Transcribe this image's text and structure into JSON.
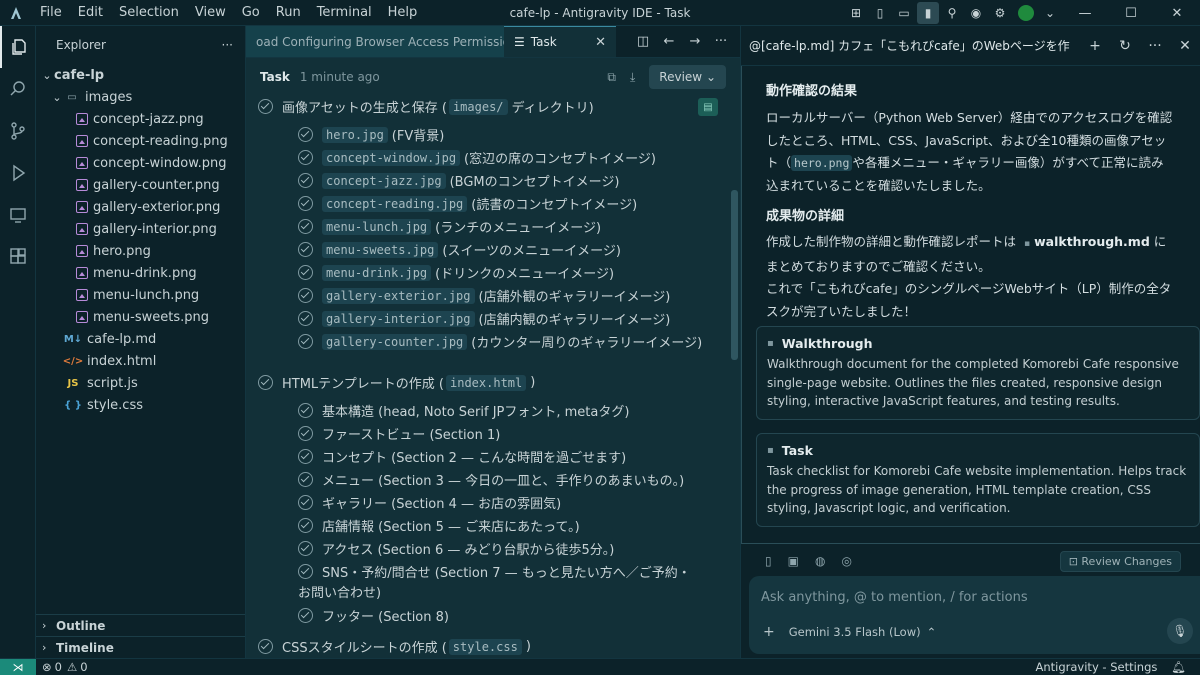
{
  "titlebar": {
    "menu": [
      "File",
      "Edit",
      "Selection",
      "View",
      "Go",
      "Run",
      "Terminal",
      "Help"
    ],
    "window_title": "cafe-lp - Antigravity IDE - Task"
  },
  "sidebar": {
    "title": "Explorer",
    "more": "···",
    "root": "cafe-lp",
    "folder": "images",
    "images": [
      "concept-jazz.png",
      "concept-reading.png",
      "concept-window.png",
      "gallery-counter.png",
      "gallery-exterior.png",
      "gallery-interior.png",
      "hero.png",
      "menu-drink.png",
      "menu-lunch.png",
      "menu-sweets.png"
    ],
    "files": [
      {
        "name": "cafe-lp.md",
        "icon": "M↓",
        "color": "#5fa8d3"
      },
      {
        "name": "index.html",
        "icon": "</>",
        "color": "#e07b3c"
      },
      {
        "name": "script.js",
        "icon": "JS",
        "color": "#e8c547"
      },
      {
        "name": "style.css",
        "icon": "{ }",
        "color": "#4aa3d6"
      }
    ],
    "outline": "Outline",
    "timeline": "Timeline"
  },
  "editor": {
    "tab_inactive": "oad  Configuring Browser Access Permissions",
    "tab_active": "Task",
    "task_title": "Task",
    "task_time": "1 minute ago",
    "review": "Review"
  },
  "task": {
    "section1": {
      "label": "画像アセットの生成と保存 (",
      "code": "images/",
      "suffix": " ディレクトリ)"
    },
    "assets": [
      {
        "code": "hero.jpg",
        "desc": "(FV背景)"
      },
      {
        "code": "concept-window.jpg",
        "desc": "(窓辺の席のコンセプトイメージ)"
      },
      {
        "code": "concept-jazz.jpg",
        "desc": "(BGMのコンセプトイメージ)"
      },
      {
        "code": "concept-reading.jpg",
        "desc": "(読書のコンセプトイメージ)"
      },
      {
        "code": "menu-lunch.jpg",
        "desc": "(ランチのメニューイメージ)"
      },
      {
        "code": "menu-sweets.jpg",
        "desc": "(スイーツのメニューイメージ)"
      },
      {
        "code": "menu-drink.jpg",
        "desc": "(ドリンクのメニューイメージ)"
      },
      {
        "code": "gallery-exterior.jpg",
        "desc": "(店舗外観のギャラリーイメージ)"
      },
      {
        "code": "gallery-interior.jpg",
        "desc": "(店舗内観のギャラリーイメージ)"
      },
      {
        "code": "gallery-counter.jpg",
        "desc": "(カウンター周りのギャラリーイメージ)"
      }
    ],
    "section2": {
      "label": "HTMLテンプレートの作成 (",
      "code": "index.html",
      "suffix": ")"
    },
    "html_items": [
      "基本構造 (head, Noto Serif JPフォント, metaタグ)",
      "ファーストビュー (Section 1)",
      "コンセプト (Section 2 — こんな時間を過ごせます)",
      "メニュー (Section 3 — 今日の一皿と、手作りのあまいもの。)",
      "ギャラリー (Section 4 — お店の雰囲気)",
      "店舗情報 (Section 5 — ご来店にあたって。)",
      "アクセス (Section 6 — みどり台駅から徒歩5分。)",
      "SNS・予約/問合せ (Section 7 — もっと見たい方へ／ご予約・",
      "フッター (Section 8)"
    ],
    "html_item_wrap": "お問い合わせ)",
    "section3": {
      "label": "CSSスタイルシートの作成 (",
      "code": "style.css",
      "suffix": ")"
    }
  },
  "agent": {
    "title": "@[cafe-lp.md] カフェ「こもれびcafe」のWebページを作",
    "h1": "動作確認の結果",
    "p1a": "ローカルサーバー（Python Web Server）経由でのアクセスログを確認したところ、HTML、CSS、JavaScript、および全10種類の画像アセット（",
    "p1code": "hero.png",
    "p1b": "や各種メニュー・ギャラリー画像）がすべて正常に読み込まれていることを確認いたしました。",
    "h2": "成果物の詳細",
    "p2a": "作成した制作物の詳細と動作確認レポートは",
    "p2link": "walkthrough.md",
    "p2b": "にまとめておりますのでご確認ください。",
    "p3": "これで「こもれびcafe」のシングルページWebサイト（LP）制作の全タスクが完了いたしました！",
    "cards": [
      {
        "title": "Walkthrough",
        "desc": "Walkthrough document for the completed Komorebi Cafe responsive single-page website. Outlines the files created, responsive design styling, interactive JavaScript features, and testing results."
      },
      {
        "title": "Task",
        "desc": "Task checklist for Komorebi Cafe website implementation. Helps track the progress of image generation, HTML template creation, CSS styling, Javascript logic, and verification."
      }
    ],
    "review_changes": "Review Changes",
    "placeholder": "Ask anything, @ to mention, / for actions",
    "model": "Gemini 3.5 Flash (Low)"
  },
  "status": {
    "errors": "0",
    "warnings": "0",
    "right": "Antigravity - Settings"
  }
}
